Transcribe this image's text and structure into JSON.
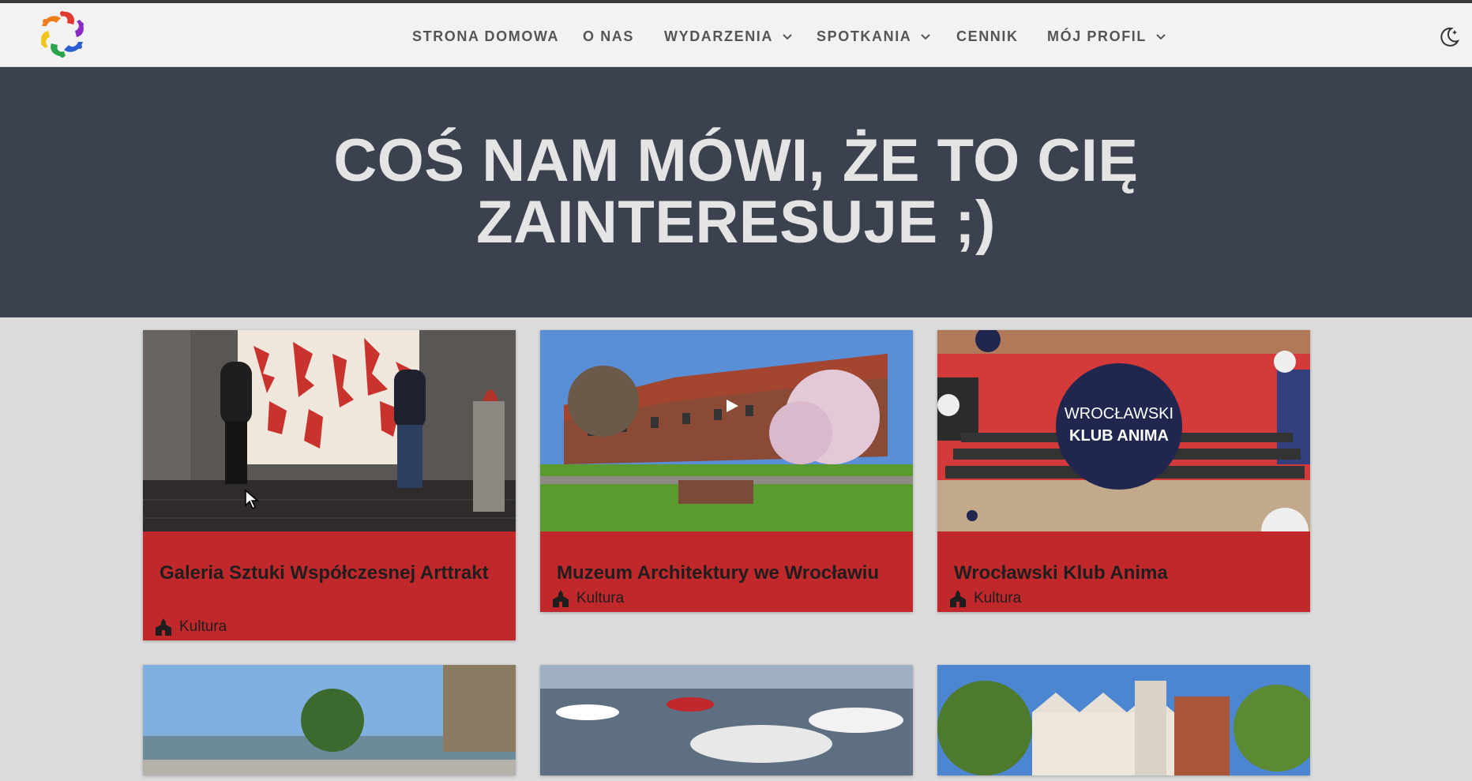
{
  "nav": {
    "items": [
      {
        "label": "STRONA DOMOWA",
        "dropdown": false
      },
      {
        "label": "O NAS",
        "dropdown": false
      },
      {
        "label": "WYDARZENIA",
        "dropdown": true
      },
      {
        "label": "SPOTKANIA",
        "dropdown": true
      },
      {
        "label": "CENNIK",
        "dropdown": false
      },
      {
        "label": "MÓJ PROFIL",
        "dropdown": true
      }
    ]
  },
  "hero": {
    "line1": "COŚ NAM MÓWI, ŻE TO CIĘ",
    "line2": "ZAINTERESUJE ;)"
  },
  "cards": [
    {
      "title": "Galeria Sztuki Współczesnej Arttrakt",
      "category": "Kultura"
    },
    {
      "title": "Muzeum Architektury we Wrocławiu",
      "category": "Kultura"
    },
    {
      "title": "Wrocławski Klub Anima",
      "category": "Kultura",
      "image_text_1": "WROCŁAWSKI",
      "image_text_2": "KLUB ANIMA"
    }
  ],
  "colors": {
    "nav_bg": "#f2f2f2",
    "hero_bg": "#3c4150",
    "card_bg": "#c0282b",
    "page_bg": "#dcdcdc"
  },
  "icons": {
    "logo": "rainbow-swirl-logo",
    "theme": "moon-icon",
    "category": "building-icon",
    "dropdown": "chevron-down-icon"
  }
}
